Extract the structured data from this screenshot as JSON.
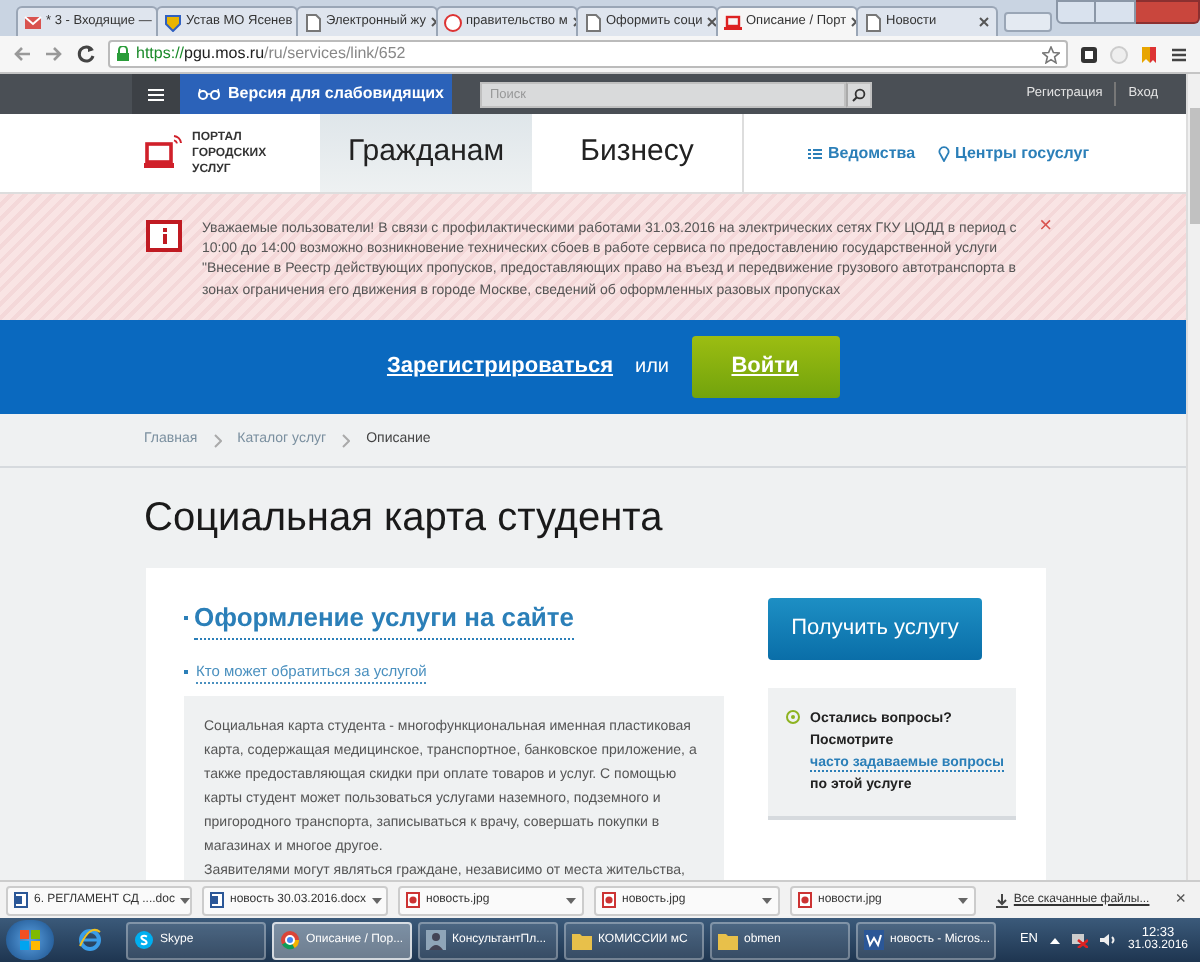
{
  "browser": {
    "tabs": [
      {
        "label": "* 3 - Входящие —",
        "kind": "mail",
        "selected": false
      },
      {
        "label": "Устав МО Ясенев",
        "kind": "emblem",
        "selected": false
      },
      {
        "label": "Электронный жу",
        "kind": "page",
        "selected": false
      },
      {
        "label": "правительство м",
        "kind": "search",
        "selected": false
      },
      {
        "label": "Оформить соци",
        "kind": "page",
        "selected": false
      },
      {
        "label": "Описание / Порт",
        "kind": "portal",
        "selected": true
      },
      {
        "label": "Новости",
        "kind": "page",
        "selected": false
      }
    ],
    "address": {
      "scheme": "https://",
      "host": "pgu.mos.ru",
      "path": "/ru/services/link/652"
    }
  },
  "site_header": {
    "accessibility_link": "Версия для слабовидящих",
    "search": {
      "placeholder": "Поиск"
    },
    "account_links": [
      "Регистрация",
      "Вход"
    ]
  },
  "nav": {
    "logo_text": "ПОРТАЛ ГОРОДСКИХ УСЛУГ",
    "sections": [
      {
        "label": "Гражданам",
        "selected": true
      },
      {
        "label": "Бизнесу",
        "selected": false
      }
    ],
    "links": [
      {
        "label": "Ведомства",
        "kind": "list"
      },
      {
        "label": "Центры госуслуг",
        "kind": "pin"
      }
    ]
  },
  "alert": {
    "text": "Уважаемые пользователи! В связи с профилактическими работами 31.03.2016 на электрических сетях ГКУ ЦОДД в период с 10:00 до 14:00 возможно возникновение технических сбоев в работе сервиса по предоставлению государственной услуги \"Внесение в Реестр действующих пропусков, предоставляющих право на въезд и передвижение грузового автотранспорта в зонах ограничения его движения в городе Москве, сведений об оформленных разовых пропусках",
    "close": "×"
  },
  "auth_bar": {
    "register": "Зарегистрироваться",
    "or": "или",
    "login": "Войти"
  },
  "breadcrumb": [
    "Главная",
    "Каталог услуг",
    "Описание"
  ],
  "title": "Социальная карта студента",
  "service": {
    "heading": "Оформление услуги на сайте",
    "sublink": "Кто может обратиться за услугой",
    "paragraphs": [
      "Социальная карта студента - многофункциональная именная пластиковая карта, содержащая медицинское, транспортное, банковское приложение, а также предоставляющая скидки при оплате товаров и услуг. С помощью карты студент может пользоваться услугами наземного, подземного и пригородного транспорта, записываться к врачу, совершать покупки в магазинах и многое другое.",
      "Заявителями могут являться граждане, независимо от места жительства,"
    ],
    "action": "Получить услугу",
    "help": {
      "lead": "Остались вопросы?",
      "before": "Посмотрите",
      "link": "часто задаваемые вопросы",
      "after": "по этой услуге"
    }
  },
  "downloads": {
    "items": [
      {
        "label": "6. РЕГЛАМЕНТ СД ....doc",
        "kind": "doc"
      },
      {
        "label": "новость 30.03.2016.docx",
        "kind": "doc"
      },
      {
        "label": "новость.jpg",
        "kind": "image"
      },
      {
        "label": "новость.jpg",
        "kind": "image"
      },
      {
        "label": "новости.jpg",
        "kind": "image"
      }
    ],
    "show_all": "Все скачанные файлы...",
    "close": "×"
  },
  "taskbar": {
    "items": [
      {
        "label": "Skype",
        "kind": "skype",
        "selected": false
      },
      {
        "label": "Описание / Пор...",
        "kind": "chrome",
        "selected": true
      },
      {
        "label": "КонсультантПл...",
        "kind": "person",
        "selected": false
      },
      {
        "label": "КОМИССИИ мС",
        "kind": "folder",
        "selected": false
      },
      {
        "label": "obmen",
        "kind": "folder",
        "selected": false
      },
      {
        "label": "новость - Micros...",
        "kind": "word",
        "selected": false
      }
    ],
    "language": "EN",
    "time": "12:33",
    "date": "31.03.2016"
  }
}
